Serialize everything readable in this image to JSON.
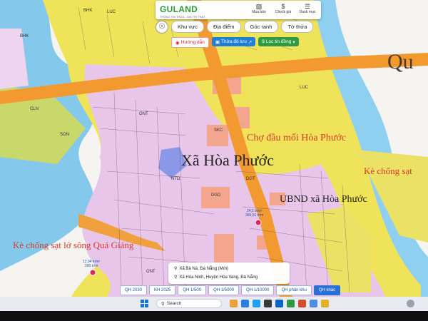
{
  "header": {
    "brand": "GULAND",
    "tagline": "THÔNG TIN THỬA - GIÁ TRỊ THẬT",
    "buttons": [
      {
        "label": "Mua bán",
        "icon": "store-icon"
      },
      {
        "label": "Check giá",
        "icon": "dollar-icon"
      },
      {
        "label": "Danh mục",
        "icon": "menu-icon"
      }
    ]
  },
  "nav_tabs": [
    "Khu vực",
    "Địa điểm",
    "Góc ranh",
    "Tờ thửa"
  ],
  "tools": {
    "route": "Hướng dẫn",
    "parcel_docs": "Thửa đô lưu",
    "filter": "Lọc tin đồng"
  },
  "map": {
    "labels": {
      "commune": "Xã Hòa Phước",
      "market": "Chợ đầu mối Hòa Phước",
      "people_committee": "UBND xã Hòa Phước",
      "embankment_left": "Kè chống sạt lở sông Quá Giáng",
      "embankment_right": "Kè chống sạt",
      "top_right": "Qu"
    },
    "zone_codes": [
      "BHK",
      "LUC",
      "CLN",
      "ONT",
      "SON",
      "DGD",
      "SKC",
      "NTD",
      "DGT",
      "BHK",
      "LUC",
      "ONT"
    ],
    "price_markers": [
      {
        "line1": "24,1 tr/m²",
        "line2": "366,51 tr/m"
      },
      {
        "line1": "12,94 tr/m²",
        "line2": "300 tr/m"
      }
    ]
  },
  "location": {
    "line1": "Xã Bà Nà, Đà Nẵng (Mới)",
    "line2": "Xã Hòa Ninh, Huyện Hòa Vang, Đà Nẵng"
  },
  "scale_tabs": [
    {
      "label": "QH 2030",
      "active": false
    },
    {
      "label": "KH 2025",
      "active": false
    },
    {
      "label": "QH 1/500",
      "active": false
    },
    {
      "label": "QH 1/5000",
      "active": false
    },
    {
      "label": "QH 1/10000",
      "active": false
    },
    {
      "label": "QH phân khu",
      "active": false
    },
    {
      "label": "QH khác",
      "active": true
    }
  ],
  "taskbar": {
    "search_label": "Search"
  },
  "colors": {
    "residential": "#e6c4e8",
    "rice": "#f2ea55",
    "perennial": "#e8e27a",
    "road": "#f29a30",
    "river": "#7dc7ee",
    "public": "#f4a38e",
    "brand_green": "#2d9a3a"
  }
}
